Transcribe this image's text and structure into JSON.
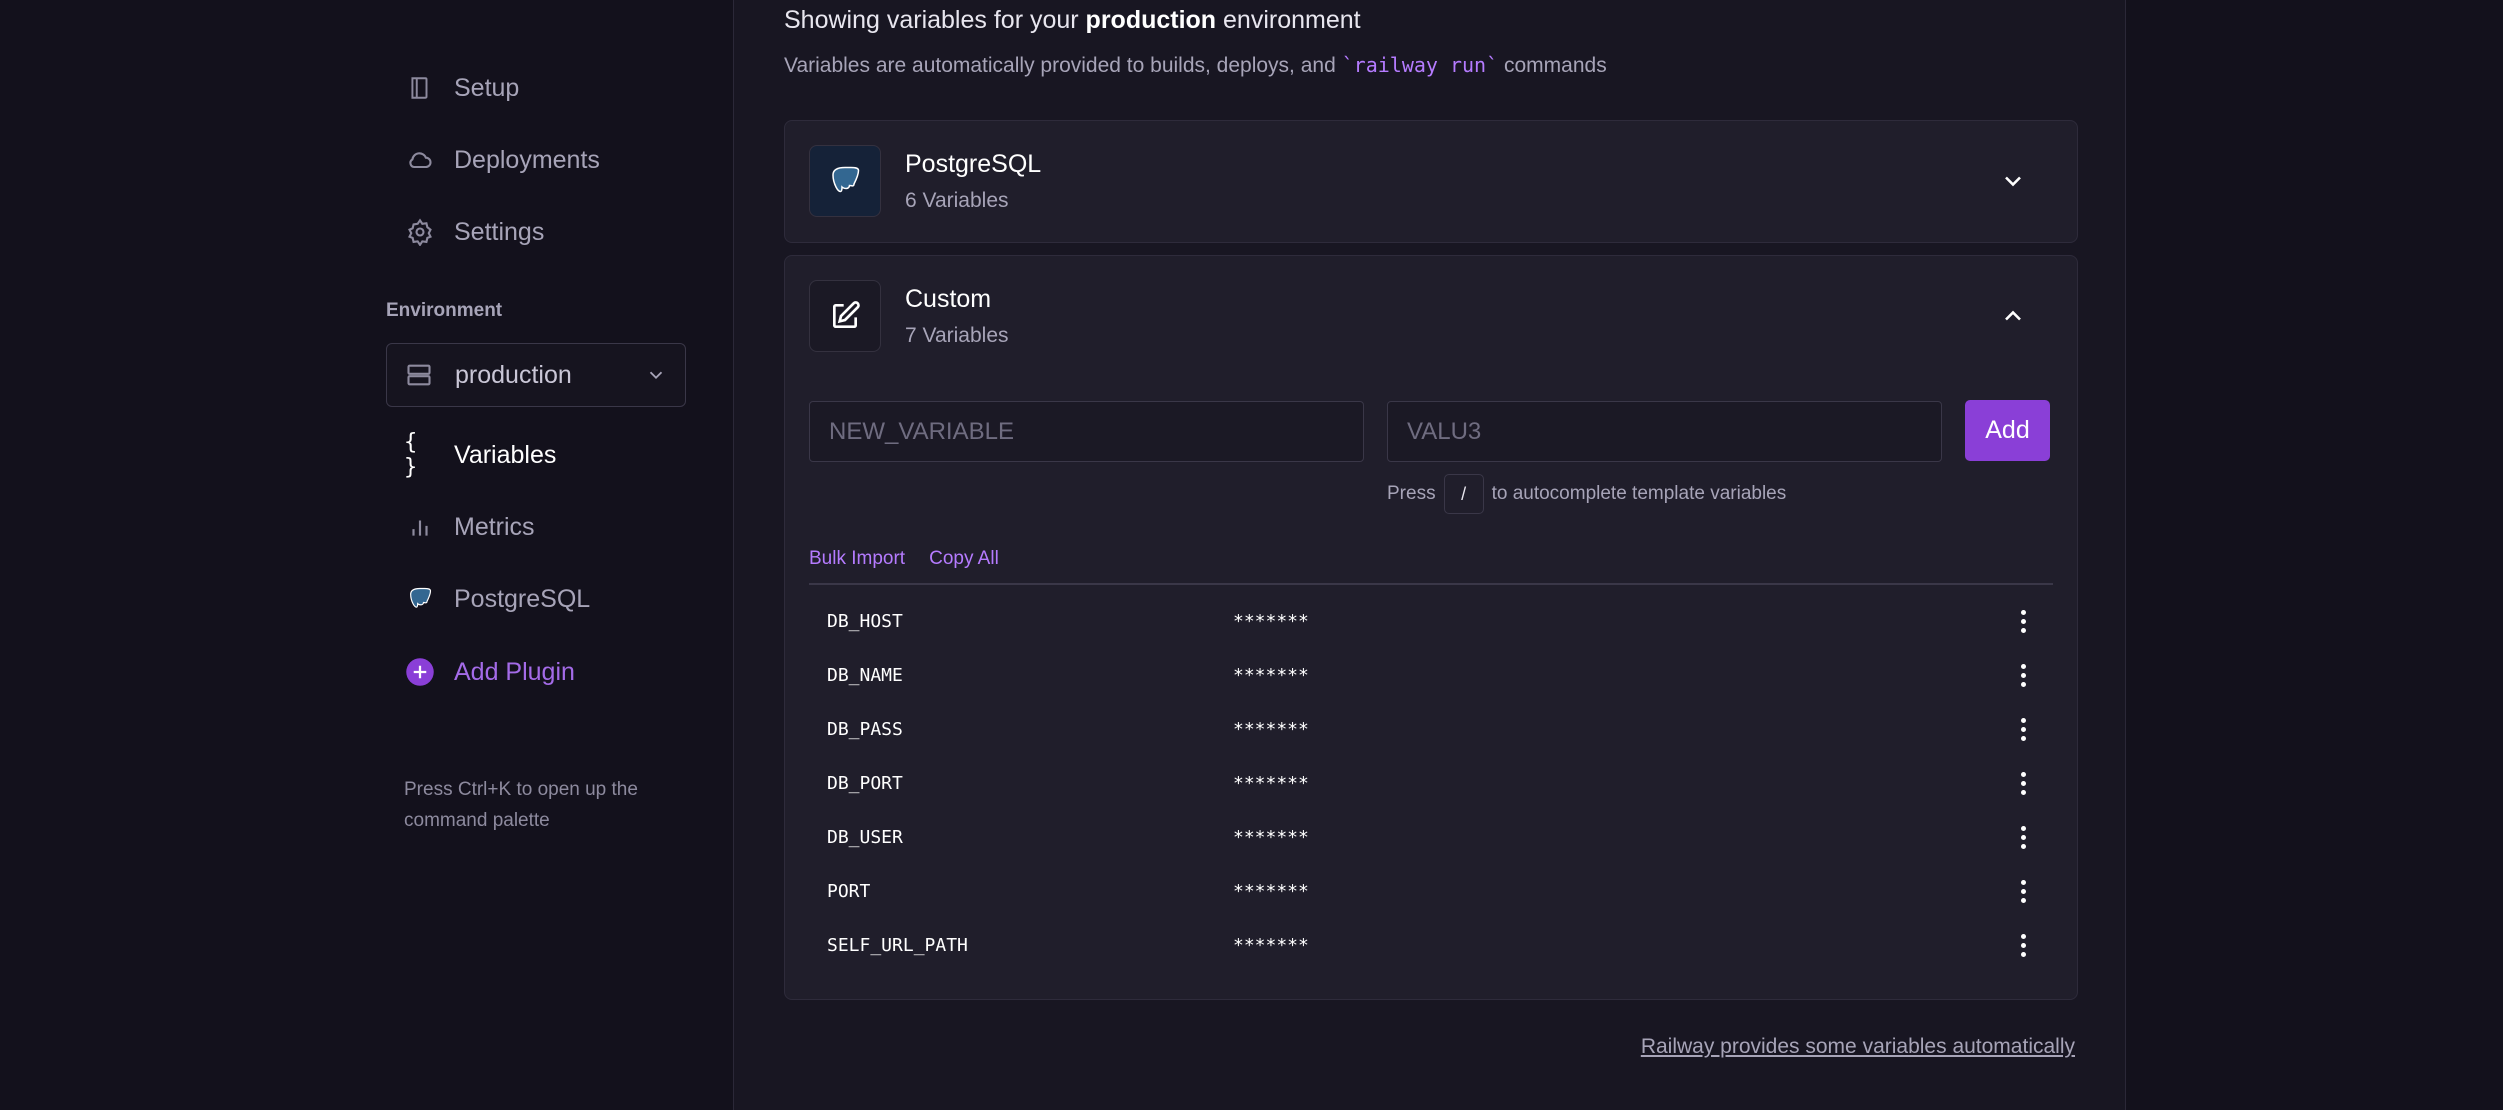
{
  "sidebar": {
    "nav": [
      {
        "label": "Setup",
        "icon": "book-icon"
      },
      {
        "label": "Deployments",
        "icon": "cloud-icon"
      },
      {
        "label": "Settings",
        "icon": "gear-icon"
      }
    ],
    "environment_label": "Environment",
    "environment_value": "production",
    "nav2": [
      {
        "label": "Variables",
        "icon": "braces-icon",
        "active": true
      },
      {
        "label": "Metrics",
        "icon": "bar-chart-icon"
      },
      {
        "label": "PostgreSQL",
        "icon": "postgres-icon"
      },
      {
        "label": "Add Plugin",
        "icon": "plus-circle-icon"
      }
    ],
    "hint": "Press Ctrl+K to open up the command palette"
  },
  "main": {
    "heading_prefix": "Showing variables for your",
    "heading_env": "production",
    "heading_suffix": "environment",
    "sub_prefix": "Variables are automatically provided to builds, deploys, and",
    "sub_code": "`railway run`",
    "sub_suffix": "commands",
    "postgres_card": {
      "title": "PostgreSQL",
      "subtitle": "6 Variables"
    },
    "custom_card": {
      "title": "Custom",
      "subtitle": "7 Variables",
      "name_placeholder": "NEW_VARIABLE",
      "value_placeholder": "VALU3",
      "add_label": "Add",
      "press_label": "Press",
      "press_key": "/",
      "press_suffix": "to autocomplete template variables",
      "bulk_import": "Bulk Import",
      "copy_all": "Copy All",
      "variables": [
        {
          "name": "DB_HOST",
          "value": "*******"
        },
        {
          "name": "DB_NAME",
          "value": "*******"
        },
        {
          "name": "DB_PASS",
          "value": "*******"
        },
        {
          "name": "DB_PORT",
          "value": "*******"
        },
        {
          "name": "DB_USER",
          "value": "*******"
        },
        {
          "name": "PORT",
          "value": "*******"
        },
        {
          "name": "SELF_URL_PATH",
          "value": "*******"
        }
      ]
    },
    "footer_link": "Railway provides some variables automatically"
  },
  "colors": {
    "accent": "#8a3fd7",
    "background": "#13111c",
    "panel": "#181622"
  }
}
